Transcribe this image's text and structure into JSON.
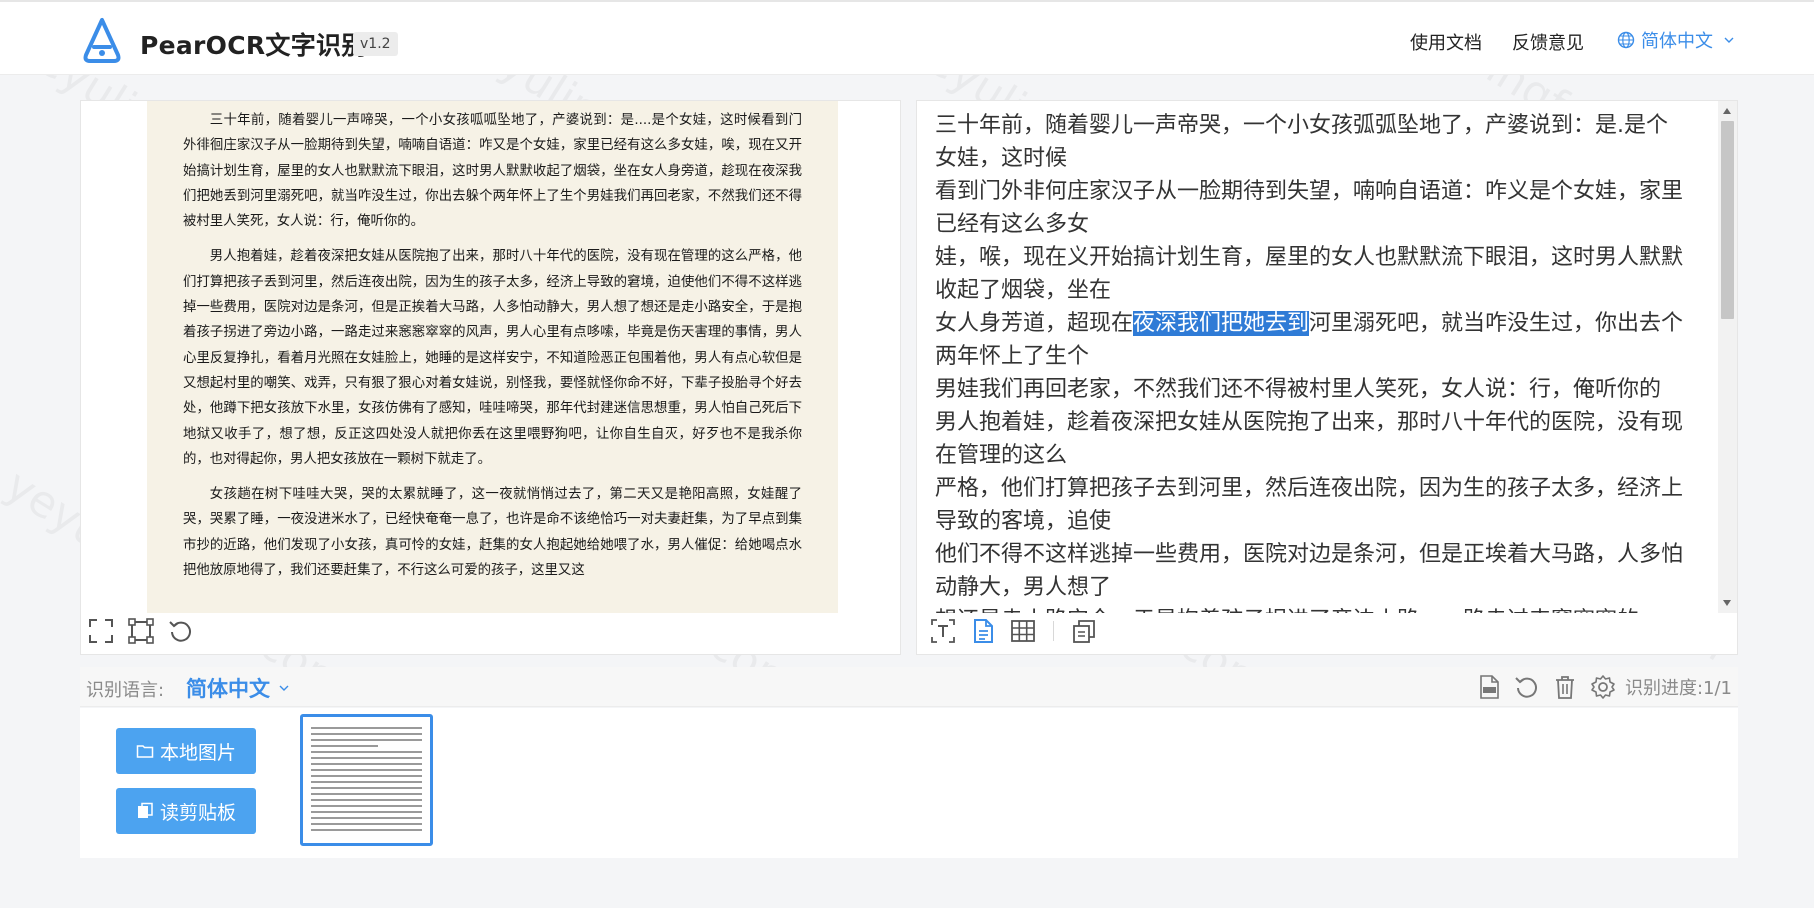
{
  "header": {
    "app_name": "PearOCR文字识别",
    "version": "v1.2",
    "nav": {
      "docs": "使用文档",
      "feedback": "反馈意见",
      "language": "简体中文"
    }
  },
  "source_image": {
    "paragraphs": [
      "三十年前，随着婴儿一声啼哭，一个小女孩呱呱坠地了，产婆说到：是....是个女娃，这时候看到门外徘徊庄家汉子从一脸期待到失望，喃喃自语道：咋又是个女娃，家里已经有这么多女娃，唉，现在又开始搞计划生育，屋里的女人也默默流下眼泪，这时男人默默收起了烟袋，坐在女人身旁道，趁现在夜深我们把她丢到河里溺死吧，就当咋没生过，你出去躲个两年怀上了生个男娃我们再回老家，不然我们还不得被村里人笑死，女人说：行，俺听你的。",
      "男人抱着娃，趁着夜深把女娃从医院抱了出来，那时八十年代的医院，没有现在管理的这么严格，他们打算把孩子丢到河里，然后连夜出院，因为生的孩子太多，经济上导致的窘境，迫使他们不得不这样逃掉一些费用，医院对边是条河，但是正挨着大马路，人多怕动静大，男人想了想还是走小路安全，于是抱着孩子拐进了旁边小路，一路走过来窸窸窣窣的风声，男人心里有点哆嗦，毕竟是伤天害理的事情，男人心里反复挣扎，看着月光照在女娃脸上，她睡的是这样安宁，不知道险恶正包围着他，男人有点心软但是又想起村里的嘲笑、戏弄，只有狠了狠心对着女娃说，别怪我，要怪就怪你命不好，下辈子投胎寻个好去处，他蹲下把女孩放下水里，女孩仿佛有了感知，哇哇啼哭，那年代封建迷信思想重，男人怕自己死后下地狱又收手了，想了想，反正这四处没人就把你丢在这里喂野狗吧，让你自生自灭，好歹也不是我杀你的，也对得起你，男人把女孩放在一颗树下就走了。",
      "女孩趟在树下哇哇大哭，哭的太累就睡了，这一夜就悄悄过去了，第二天又是艳阳高照，女娃醒了哭，哭累了睡，一夜没进米水了，已经快奄奄一息了，也许是命不该绝恰巧一对夫妻赶集，为了早点到集市抄的近路，他们发现了小女孩，真可怜的女娃，赶集的女人抱起她给她喂了水，男人催促：给她喝点水把他放原地得了，我们还要赶集了，不行这么可爱的孩子，这里又这"
    ]
  },
  "ocr_result": {
    "lines": [
      {
        "text": "三十年前，随着婴儿一声帝哭，一个小女孩弧弧坠地了，产婆说到：是.是个女娃，这时候"
      },
      {
        "text": "看到门外非何庄家汉子从一脸期待到失望，喃响自语道：咋义是个女娃，家里已经有这么多女"
      },
      {
        "text": "娃，喉，现在义开始搞计划生育，屋里的女人也默默流下眼泪，这时男人默默收起了烟袋，坐在"
      },
      {
        "pre": "女人身芳道，超现在",
        "highlight": "夜深我们把她去到",
        "post": "河里溺死吧，就当咋没生过，你出去个两年怀上了生个"
      },
      {
        "text": "男娃我们再回老家，不然我们还不得被村里人笑死，女人说：行，俺听你的"
      },
      {
        "text": "男人抱着娃，趁着夜深把女娃从医院抱了出来，那时八十年代的医院，没有现在管理的这么"
      },
      {
        "text": "严格，他们打算把孩子去到河里，然后连夜出院，因为生的孩子太多，经济上导致的客境，追使"
      },
      {
        "text": "他们不得不这样逃掉一些费用，医院对边是条河，但是正埃着大马路，人多怕动静大，男人想了"
      },
      {
        "text": "想还是走小路安全，于是抱着孩子拐进了旁边小路，一路走过来窸窣窣的"
      }
    ]
  },
  "bottom": {
    "lang_label": "识别语言:",
    "lang_value": "简体中文",
    "progress": "识别进度:1/1",
    "local_image_btn": "本地图片",
    "clipboard_btn": "读剪贴板"
  },
  "watermark": "yeyulingfeng.com",
  "colors": {
    "accent": "#3b8de8",
    "button": "#4ca3f0",
    "highlight": "#2f7bd6",
    "paper": "#f6f2e6"
  },
  "icons": {
    "logo": "pear-a-logo",
    "language": "globe-icon",
    "left_tools": [
      "fullscreen-icon",
      "crop-icon",
      "rotate-icon"
    ],
    "right_tools": [
      "text-layout-icon",
      "document-icon",
      "table-icon",
      "copy-icon"
    ],
    "bar_tools": [
      "pdf-icon",
      "refresh-icon",
      "trash-icon",
      "settings-icon"
    ]
  }
}
